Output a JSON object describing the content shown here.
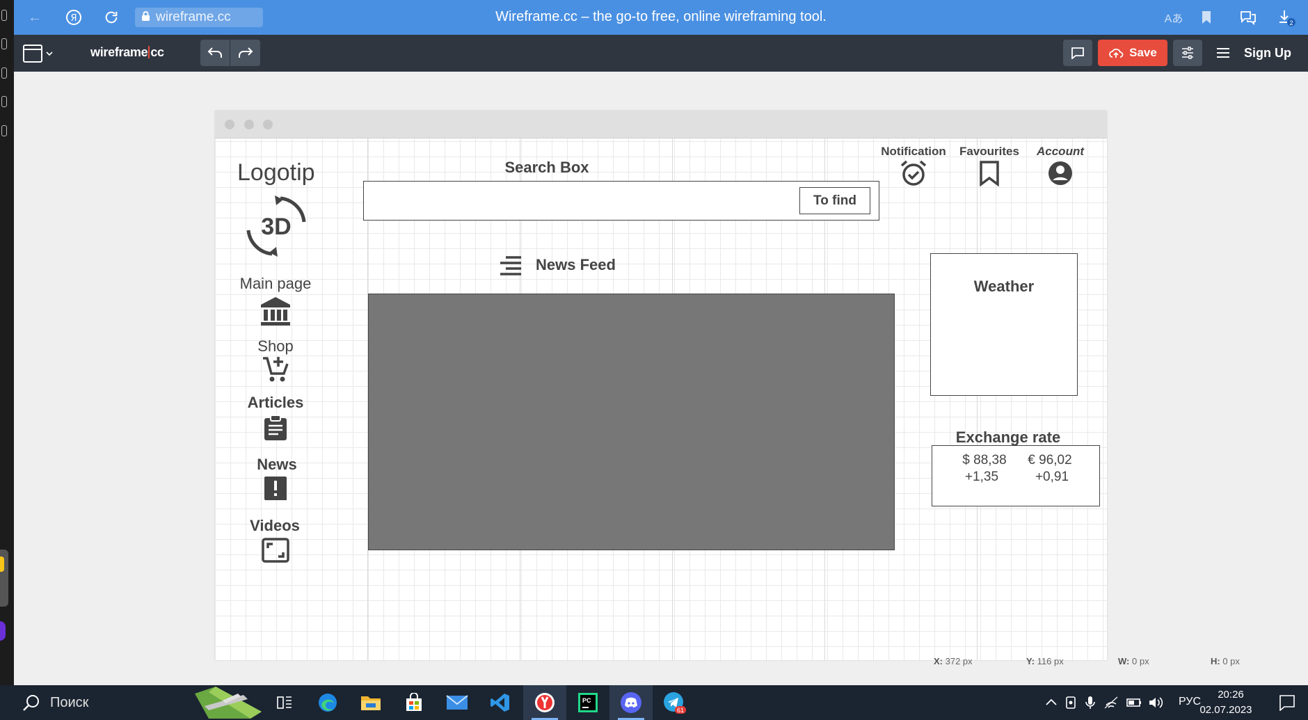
{
  "browser": {
    "url": "wireframe.cc",
    "page_title": "Wireframe.cc – the go-to free, online wireframing tool.",
    "download_badge": "2"
  },
  "app": {
    "brand_left": "wireframe",
    "brand_right": "cc",
    "save_label": "Save",
    "signup_label": "Sign Up"
  },
  "wireframe": {
    "logo_text": "Logotip",
    "logo_3d": "3D",
    "nav": [
      {
        "label": "Main page",
        "icon": "bank-icon"
      },
      {
        "label": "Shop",
        "icon": "cart-add-icon"
      },
      {
        "label": "Articles",
        "icon": "clipboard-icon"
      },
      {
        "label": "News",
        "icon": "alert-icon"
      },
      {
        "label": "Videos",
        "icon": "fullscreen-icon"
      }
    ],
    "search_title": "Search Box",
    "search_button": "To find",
    "header_items": [
      {
        "label": "Notification",
        "icon": "alarm-check-icon"
      },
      {
        "label": "Favourites",
        "icon": "bookmark-icon"
      },
      {
        "label": "Account",
        "icon": "account-icon"
      }
    ],
    "news_feed_title": "News Feed",
    "weather_title": "Weather",
    "exchange_title": "Exchange rate",
    "usd_rate": "$ 88,38",
    "eur_rate": "€ 96,02",
    "usd_change": "+1,35",
    "eur_change": "+0,91"
  },
  "status": {
    "x": "372 px",
    "y": "116 px",
    "w": "0 px",
    "h": "0 px"
  },
  "taskbar": {
    "search_placeholder": "Поиск",
    "telegram_badge": "61",
    "language": "РУС",
    "time": "20:26",
    "date": "02.07.2023"
  },
  "colors": {
    "browser_bar": "#4a90e2",
    "toolbar": "#2f3640",
    "save_button": "#e74c3c",
    "image_placeholder": "#777777"
  }
}
